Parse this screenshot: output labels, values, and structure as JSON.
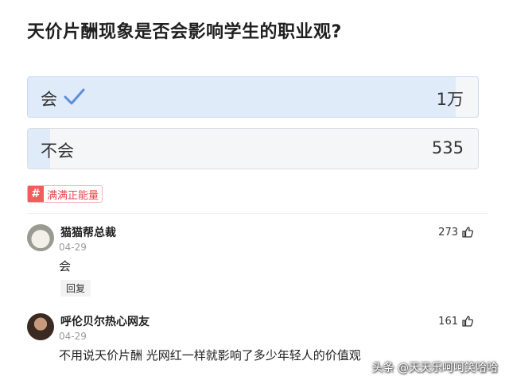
{
  "poll": {
    "question": "天价片酬现象是否会影响学生的职业观?",
    "options": [
      {
        "label": "会",
        "count": "1万",
        "selected": true,
        "share": 0.95
      },
      {
        "label": "不会",
        "count": "535",
        "selected": false,
        "share": 0.05
      }
    ],
    "accent_color": "#5b8fd8"
  },
  "topic": {
    "hash_symbol": "#",
    "label": "满满正能量"
  },
  "comments": [
    {
      "user": "猫猫帮总裁",
      "date": "04-29",
      "text": "会",
      "likes": "273",
      "reply_label": "回复"
    },
    {
      "user": "呼伦贝尔热心网友",
      "date": "04-29",
      "text": "不用说天价片酬 光网红一样就影响了多少年轻人的价值观",
      "likes": "161"
    }
  ],
  "watermark": "头条 @天天乐呵呵笑哈哈",
  "icons": {
    "check": "check-icon",
    "thumb": "thumbs-up-icon",
    "hash": "hash-icon"
  }
}
